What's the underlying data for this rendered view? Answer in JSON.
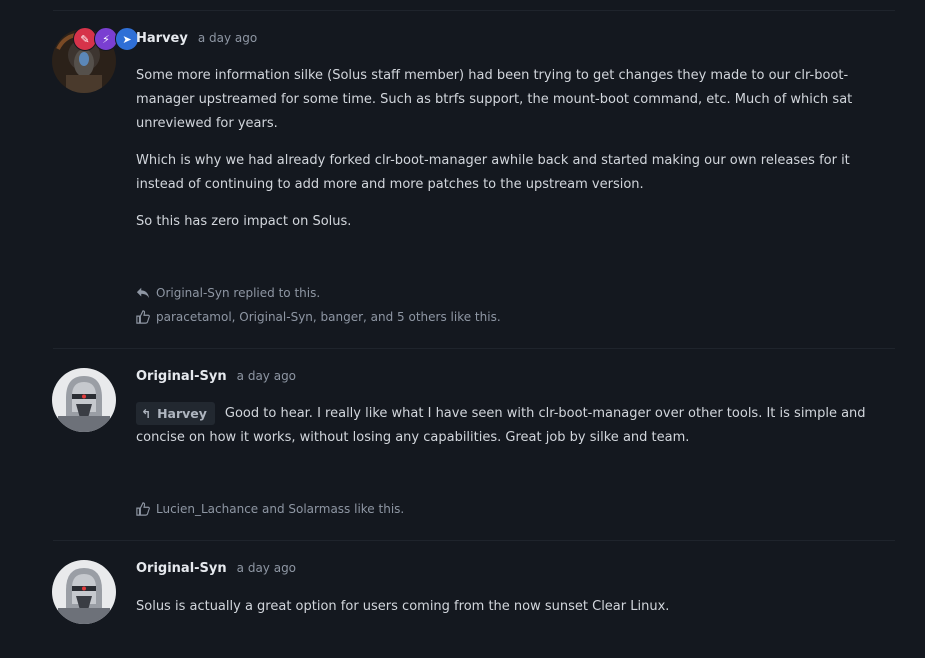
{
  "posts": [
    {
      "author": "Harvey",
      "time": "a day ago",
      "badge_colors": [
        "#d6334a",
        "#7a3fd1",
        "#2f6fd6"
      ],
      "paragraphs": [
        "Some more information silke (Solus staff member) had been trying to get changes they made to our clr-boot-manager upstreamed for some time. Such as btrfs support, the mount-boot command, etc. Much of which sat unreviewed for years.",
        "Which is why we had already forked clr-boot-manager awhile back and started making our own releases for it instead of continuing to add more and more patches to the upstream version.",
        "So this has zero impact on Solus."
      ],
      "replied_text": "Original-Syn replied to this.",
      "likes_text": "paracetamol, Original-Syn, banger, and 5 others like this."
    },
    {
      "author": "Original-Syn",
      "time": "a day ago",
      "reply_to": "Harvey",
      "paragraphs": [
        "Good to hear. I really like what I have seen with clr-boot-manager over other tools. It is simple and concise on how it works, without losing any capabilities. Great job by silke and team."
      ],
      "likes_text": "Lucien_Lachance and Solarmass like this."
    },
    {
      "author": "Original-Syn",
      "time": "a day ago",
      "paragraphs": [
        "Solus is actually a great option for users coming from the now sunset Clear Linux."
      ]
    }
  ]
}
